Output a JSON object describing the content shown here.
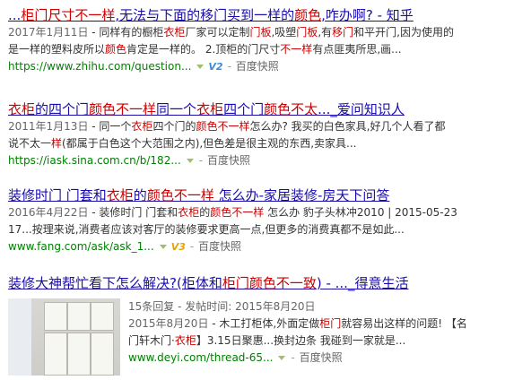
{
  "results": [
    {
      "title_parts": [
        {
          "t": "...",
          "h": false
        },
        {
          "t": "柜门尺寸不一样",
          "h": true
        },
        {
          "t": ",无法与下面的移门买到一样的",
          "h": false
        },
        {
          "t": "颜色",
          "h": true
        },
        {
          "t": ",咋办啊? - 知乎",
          "h": false
        }
      ],
      "abstract_lines": [
        [
          {
            "t": "2017年1月11日",
            "c": "date"
          },
          {
            "t": " - 同样有的橱柜",
            "c": ""
          },
          {
            "t": "衣柜",
            "c": "hl"
          },
          {
            "t": "厂家可以定制",
            "c": ""
          },
          {
            "t": "门板",
            "c": "hl"
          },
          {
            "t": ",吸塑",
            "c": ""
          },
          {
            "t": "门板",
            "c": "hl"
          },
          {
            "t": ",有",
            "c": ""
          },
          {
            "t": "移门",
            "c": "hl"
          },
          {
            "t": "和平开门,因为使用的",
            "c": ""
          }
        ],
        [
          {
            "t": "是一样的塑料皮所以",
            "c": ""
          },
          {
            "t": "颜色",
            "c": "hl"
          },
          {
            "t": "肯定是一样的。 2.顶柜的门尺寸",
            "c": ""
          },
          {
            "t": "不一样",
            "c": "hl"
          },
          {
            "t": "有点匪夷所思,画...",
            "c": ""
          }
        ]
      ],
      "url": "https://www.zhihu.com/question...",
      "badge": "V2",
      "badge_style": "blue",
      "snapshot": "百度快照"
    },
    {
      "title_parts": [
        {
          "t": "衣柜",
          "h": true
        },
        {
          "t": "的四个门",
          "h": false
        },
        {
          "t": "颜色不一样",
          "h": true
        },
        {
          "t": "同一个",
          "h": false
        },
        {
          "t": "衣柜",
          "h": true
        },
        {
          "t": "四个门",
          "h": false
        },
        {
          "t": "颜色不太",
          "h": true
        },
        {
          "t": "..._爱问知识人",
          "h": false
        }
      ],
      "abstract_lines": [
        [
          {
            "t": "2011年1月13日",
            "c": "date"
          },
          {
            "t": " - 同一个",
            "c": ""
          },
          {
            "t": "衣柜",
            "c": "hl"
          },
          {
            "t": "四个门的",
            "c": ""
          },
          {
            "t": "颜色不一样",
            "c": "hl"
          },
          {
            "t": "怎么办? 我买的白色家具,好几个人看了都",
            "c": ""
          }
        ],
        [
          {
            "t": "说不太",
            "c": ""
          },
          {
            "t": "一样",
            "c": "hl"
          },
          {
            "t": "(都属于白色这个大范围之内),但色差是很主观的东西,卖家具...",
            "c": ""
          }
        ]
      ],
      "url": "https://iask.sina.com.cn/b/182...",
      "badge": "",
      "badge_style": "",
      "snapshot": "百度快照"
    },
    {
      "title_parts": [
        {
          "t": "装修时门 门套和",
          "h": false
        },
        {
          "t": "衣柜",
          "h": true
        },
        {
          "t": "的",
          "h": false
        },
        {
          "t": "颜色不一样",
          "h": true
        },
        {
          "t": " 怎么办-家居装修-房天下问答",
          "h": false
        }
      ],
      "abstract_lines": [
        [
          {
            "t": "2016年4月22日",
            "c": "date"
          },
          {
            "t": " - 装修时门 门套和",
            "c": ""
          },
          {
            "t": "衣柜",
            "c": "hl"
          },
          {
            "t": "的",
            "c": ""
          },
          {
            "t": "颜色不一样",
            "c": "hl"
          },
          {
            "t": " 怎么办 豹子头林冲2010 | 2015-05-23",
            "c": ""
          }
        ],
        [
          {
            "t": "17...按理来说,消费者应该对客厅的装修要求更高一点,但更多的消费真都不是如此...",
            "c": ""
          }
        ]
      ],
      "url": "www.fang.com/ask/ask_1...",
      "badge": "V3",
      "badge_style": "gold",
      "snapshot": "百度快照"
    },
    {
      "title_parts": [
        {
          "t": "装修大神帮忙看下怎么解决?(柜体和",
          "h": false
        },
        {
          "t": "柜门颜色不一致",
          "h": true
        },
        {
          "t": ") - ..._得意生活",
          "h": false
        }
      ],
      "abstract_lines": [
        [
          {
            "t": "15条回复 - 发帖时间: 2015年8月20日",
            "c": "date"
          }
        ],
        [
          {
            "t": "2015年8月20日",
            "c": "date"
          },
          {
            "t": " - 木工打柜体,外面定做",
            "c": ""
          },
          {
            "t": "柜门",
            "c": "hl"
          },
          {
            "t": "就容易出这样的问题! 【名",
            "c": ""
          }
        ],
        [
          {
            "t": "门轩木门·",
            "c": ""
          },
          {
            "t": "衣柜",
            "c": "hl"
          },
          {
            "t": "】3.15日聚惠...换封边条 我碰到一家就是...",
            "c": ""
          }
        ]
      ],
      "url": "www.deyi.com/thread-65...",
      "badge": "",
      "badge_style": "",
      "snapshot": "百度快照",
      "thumbnail_icon": "wardrobe-photo-icon"
    }
  ]
}
